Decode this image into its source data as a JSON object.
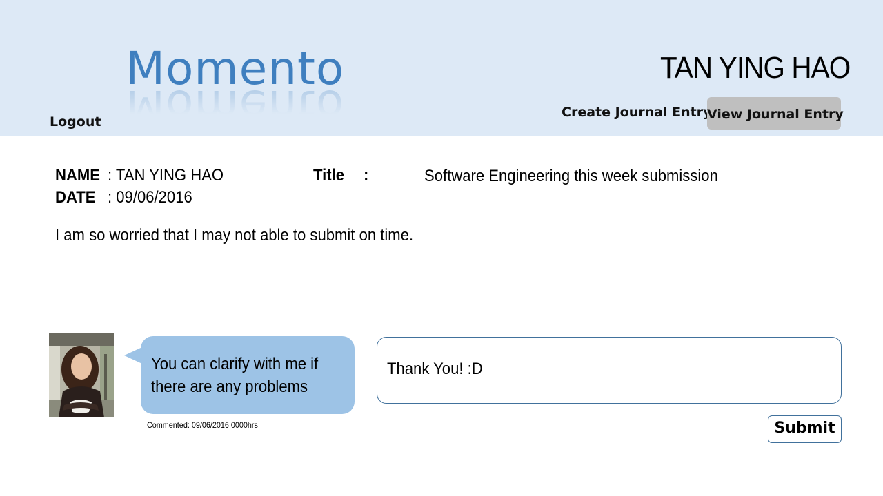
{
  "app": {
    "logo_text": "Momento",
    "user_name": "TAN YING HAO",
    "logout_label": "Logout"
  },
  "nav": {
    "create_label": "Create Journal Entry",
    "view_label": "View Journal Entry",
    "active": "View Journal Entry"
  },
  "entry": {
    "name_label": "NAME",
    "name_value": ": TAN YING HAO",
    "date_label": "DATE",
    "date_value": ": 09/06/2016",
    "title_label": "Title",
    "title_colon": ":",
    "title_value": "Software Engineering this week submission",
    "body": "I am so worried that I may not able to submit on time."
  },
  "comment": {
    "text": "You can clarify with me if there are any problems",
    "meta": "Commented:  09/06/2016  0000hrs"
  },
  "reply": {
    "value": "Thank You! :D",
    "submit_label": "Submit"
  },
  "colors": {
    "header_bg": "#dde9f6",
    "logo": "#3f7fbf",
    "bubble": "#9dc3e6",
    "active_tab": "#bfbfbf",
    "border": "#41719c"
  }
}
